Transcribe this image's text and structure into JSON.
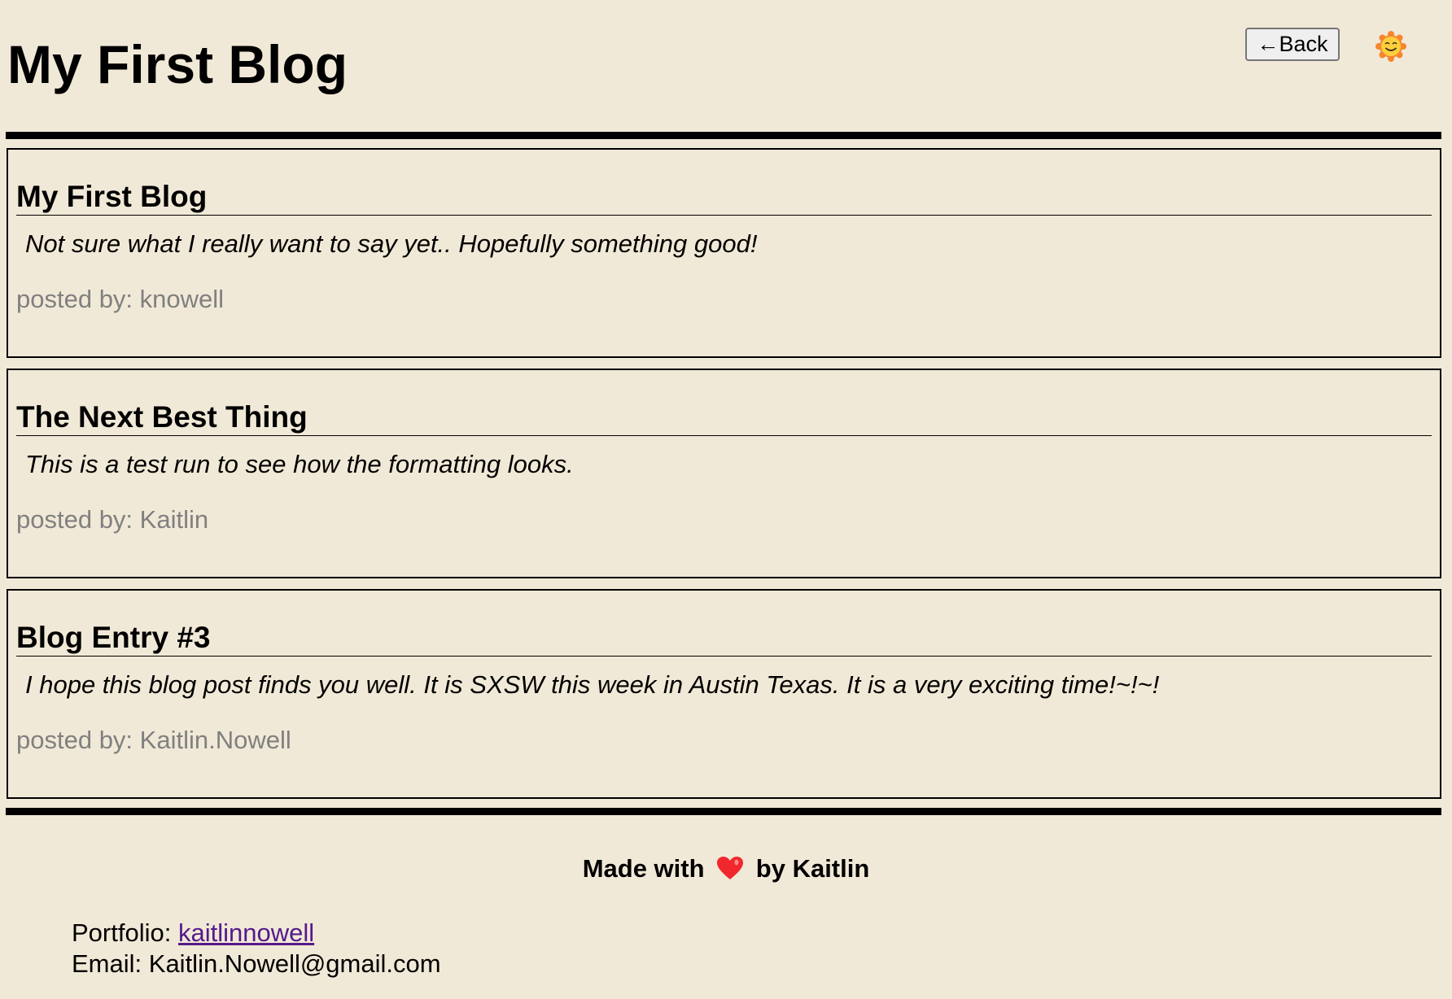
{
  "header": {
    "title": "My First Blog",
    "back_label": "←Back",
    "theme_icon": "smiling-sun-icon"
  },
  "posts": [
    {
      "title": "My First Blog",
      "body": "Not sure what I really want to say yet.. Hopefully something good!",
      "author": "posted by: knowell"
    },
    {
      "title": "The Next Best Thing",
      "body": "This is a test run to see how the formatting looks.",
      "author": "posted by: Kaitlin"
    },
    {
      "title": "Blog Entry #3",
      "body": "I hope this blog post finds you well. It is SXSW this week in Austin Texas. It is a very exciting time!~!~!",
      "author": "posted by: Kaitlin.Nowell"
    }
  ],
  "footer": {
    "made_with_prefix": "Made with",
    "made_with_suffix": "by Kaitlin",
    "portfolio_label": "Portfolio:",
    "portfolio_link": "kaitlinnowell",
    "email_label": "Email:",
    "email": "Kaitlin.Nowell@gmail.com",
    "link_color": "#551a8b"
  }
}
